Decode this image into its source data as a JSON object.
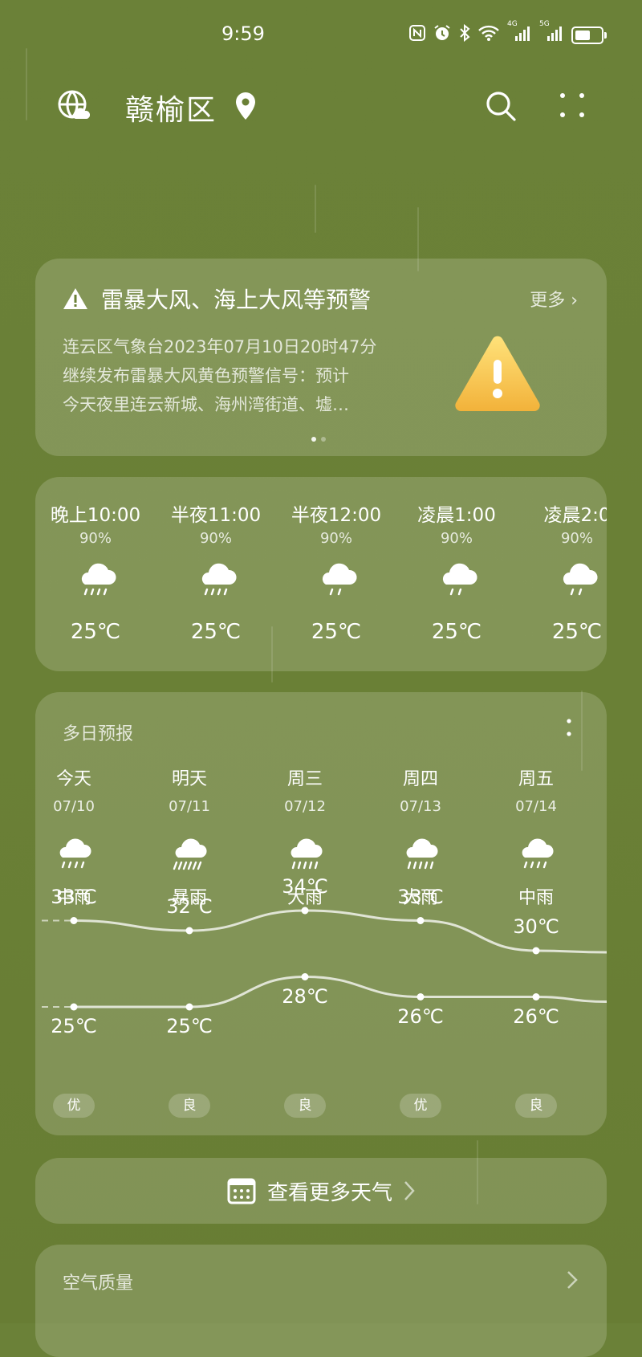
{
  "status_bar": {
    "time": "9:59",
    "signal_1": "4G",
    "signal_2": "5G"
  },
  "header": {
    "city": "赣榆区"
  },
  "alert": {
    "title": "雷暴大风、海上大风等预警",
    "more_label": "更多 ›",
    "lines": [
      "连云区气象台2023年07月10日20时47分",
      "继续发布雷暴大风黄色预警信号：预计",
      "今天夜里连云新城、海州湾街道、墟…"
    ],
    "page_count": 2,
    "page_index": 0
  },
  "hourly": [
    {
      "time": "晚上10:00",
      "precip": "90%",
      "temp": "25℃",
      "icon": "light-rain-icon"
    },
    {
      "time": "半夜11:00",
      "precip": "90%",
      "temp": "25℃",
      "icon": "light-rain-icon"
    },
    {
      "time": "半夜12:00",
      "precip": "90%",
      "temp": "25℃",
      "icon": "drizzle-icon"
    },
    {
      "time": "凌晨1:00",
      "precip": "90%",
      "temp": "25℃",
      "icon": "drizzle-icon"
    },
    {
      "time": "凌晨2:0",
      "precip": "90%",
      "temp": "25℃",
      "icon": "drizzle-icon"
    }
  ],
  "daily": {
    "title": "多日预报",
    "days": [
      {
        "name": "今天",
        "date": "07/10",
        "condition": "中雨",
        "high": "33℃",
        "low": "25℃",
        "aqi": "优",
        "high_value": 33,
        "low_value": 25,
        "icon": "moderate-rain-icon"
      },
      {
        "name": "明天",
        "date": "07/11",
        "condition": "暴雨",
        "high": "32℃",
        "low": "25℃",
        "aqi": "良",
        "high_value": 32,
        "low_value": 25,
        "icon": "rainstorm-icon"
      },
      {
        "name": "周三",
        "date": "07/12",
        "condition": "大雨",
        "high": "34℃",
        "low": "28℃",
        "aqi": "良",
        "high_value": 34,
        "low_value": 28,
        "icon": "heavy-rain-icon"
      },
      {
        "name": "周四",
        "date": "07/13",
        "condition": "大雨",
        "high": "33℃",
        "low": "26℃",
        "aqi": "优",
        "high_value": 33,
        "low_value": 26,
        "icon": "heavy-rain-icon"
      },
      {
        "name": "周五",
        "date": "07/14",
        "condition": "中雨",
        "high": "30℃",
        "low": "26℃",
        "aqi": "良",
        "high_value": 30,
        "low_value": 26,
        "icon": "moderate-rain-icon"
      }
    ]
  },
  "more_weather": {
    "label": "查看更多天气"
  },
  "air_quality": {
    "title": "空气质量"
  },
  "colors": {
    "background": "#6a8036",
    "card": "rgba(255,255,255,0.17)",
    "warning_yellow": "#f5c242"
  }
}
